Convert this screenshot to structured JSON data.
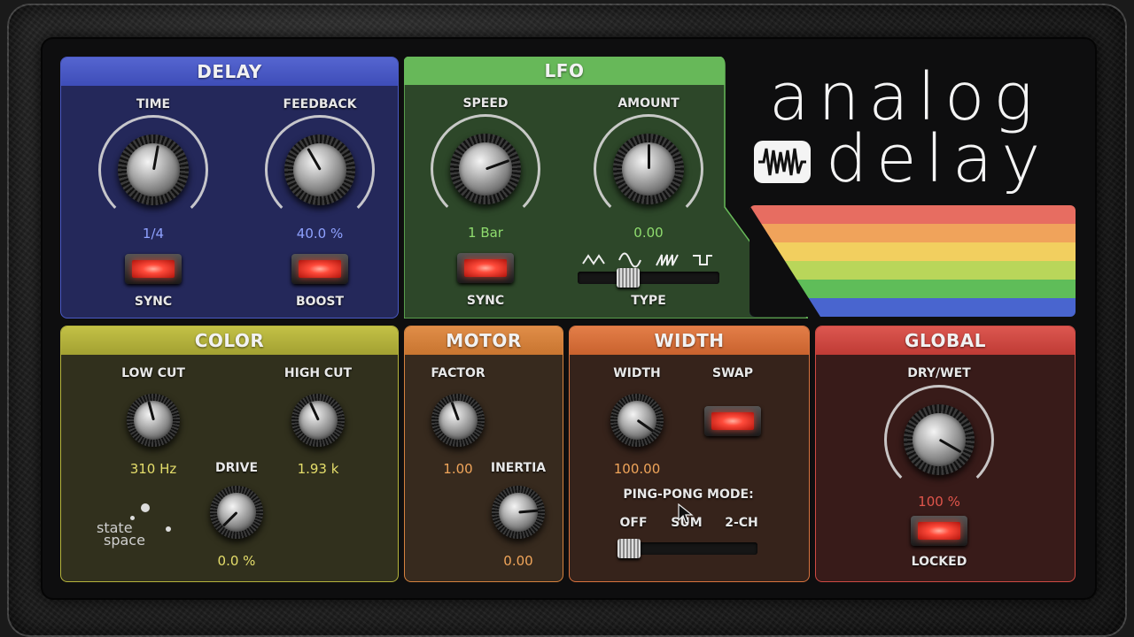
{
  "delay": {
    "title": "DELAY",
    "time_label": "TIME",
    "time_value": "1/4",
    "feedback_label": "FEEDBACK",
    "feedback_value": "40.0 %",
    "sync_label": "SYNC",
    "boost_label": "BOOST"
  },
  "lfo": {
    "title": "LFO",
    "speed_label": "SPEED",
    "speed_value": "1 Bar",
    "amount_label": "AMOUNT",
    "amount_value": "0.00",
    "sync_label": "SYNC",
    "type_label": "TYPE",
    "type_options": [
      "triangle",
      "sine",
      "sawtooth",
      "square"
    ]
  },
  "logo": {
    "line1": "analog",
    "line2": "delay"
  },
  "color": {
    "title": "COLOR",
    "low_cut_label": "LOW CUT",
    "low_cut_value": "310 Hz",
    "high_cut_label": "HIGH CUT",
    "high_cut_value": "1.93 k",
    "drive_label": "DRIVE",
    "drive_value": "0.0 %",
    "brand_line1": "state",
    "brand_line2": "space"
  },
  "motor": {
    "title": "MOTOR",
    "factor_label": "FACTOR",
    "factor_value": "1.00",
    "inertia_label": "INERTIA",
    "inertia_value": "0.00"
  },
  "width": {
    "title": "WIDTH",
    "width_label": "WIDTH",
    "width_value": "100.00",
    "swap_label": "SWAP",
    "pingpong_label": "PING-PONG MODE:",
    "pingpong_options": [
      "OFF",
      "SUM",
      "2-CH"
    ],
    "pingpong_selected": "OFF"
  },
  "global": {
    "title": "GLOBAL",
    "drywet_label": "DRY/WET",
    "drywet_value": "100 %",
    "locked_label": "LOCKED"
  },
  "colors": {
    "delay_header": "#4a59c4",
    "delay_body": "#26285a",
    "lfo_header": "#67b859",
    "lfo_body": "#2e4a2a",
    "color_header": "#b5b33c",
    "color_body": "#33321d",
    "motor_header": "#d5823e",
    "motor_body": "#3a2a1e",
    "width_header": "#d9733e",
    "width_body": "#38241b",
    "global_header": "#cf4a43",
    "global_body": "#3a1c1a",
    "stripes": [
      "#e76d61",
      "#f0a35b",
      "#f2cf5f",
      "#b9d65a",
      "#5fbd59",
      "#4965cf"
    ]
  }
}
